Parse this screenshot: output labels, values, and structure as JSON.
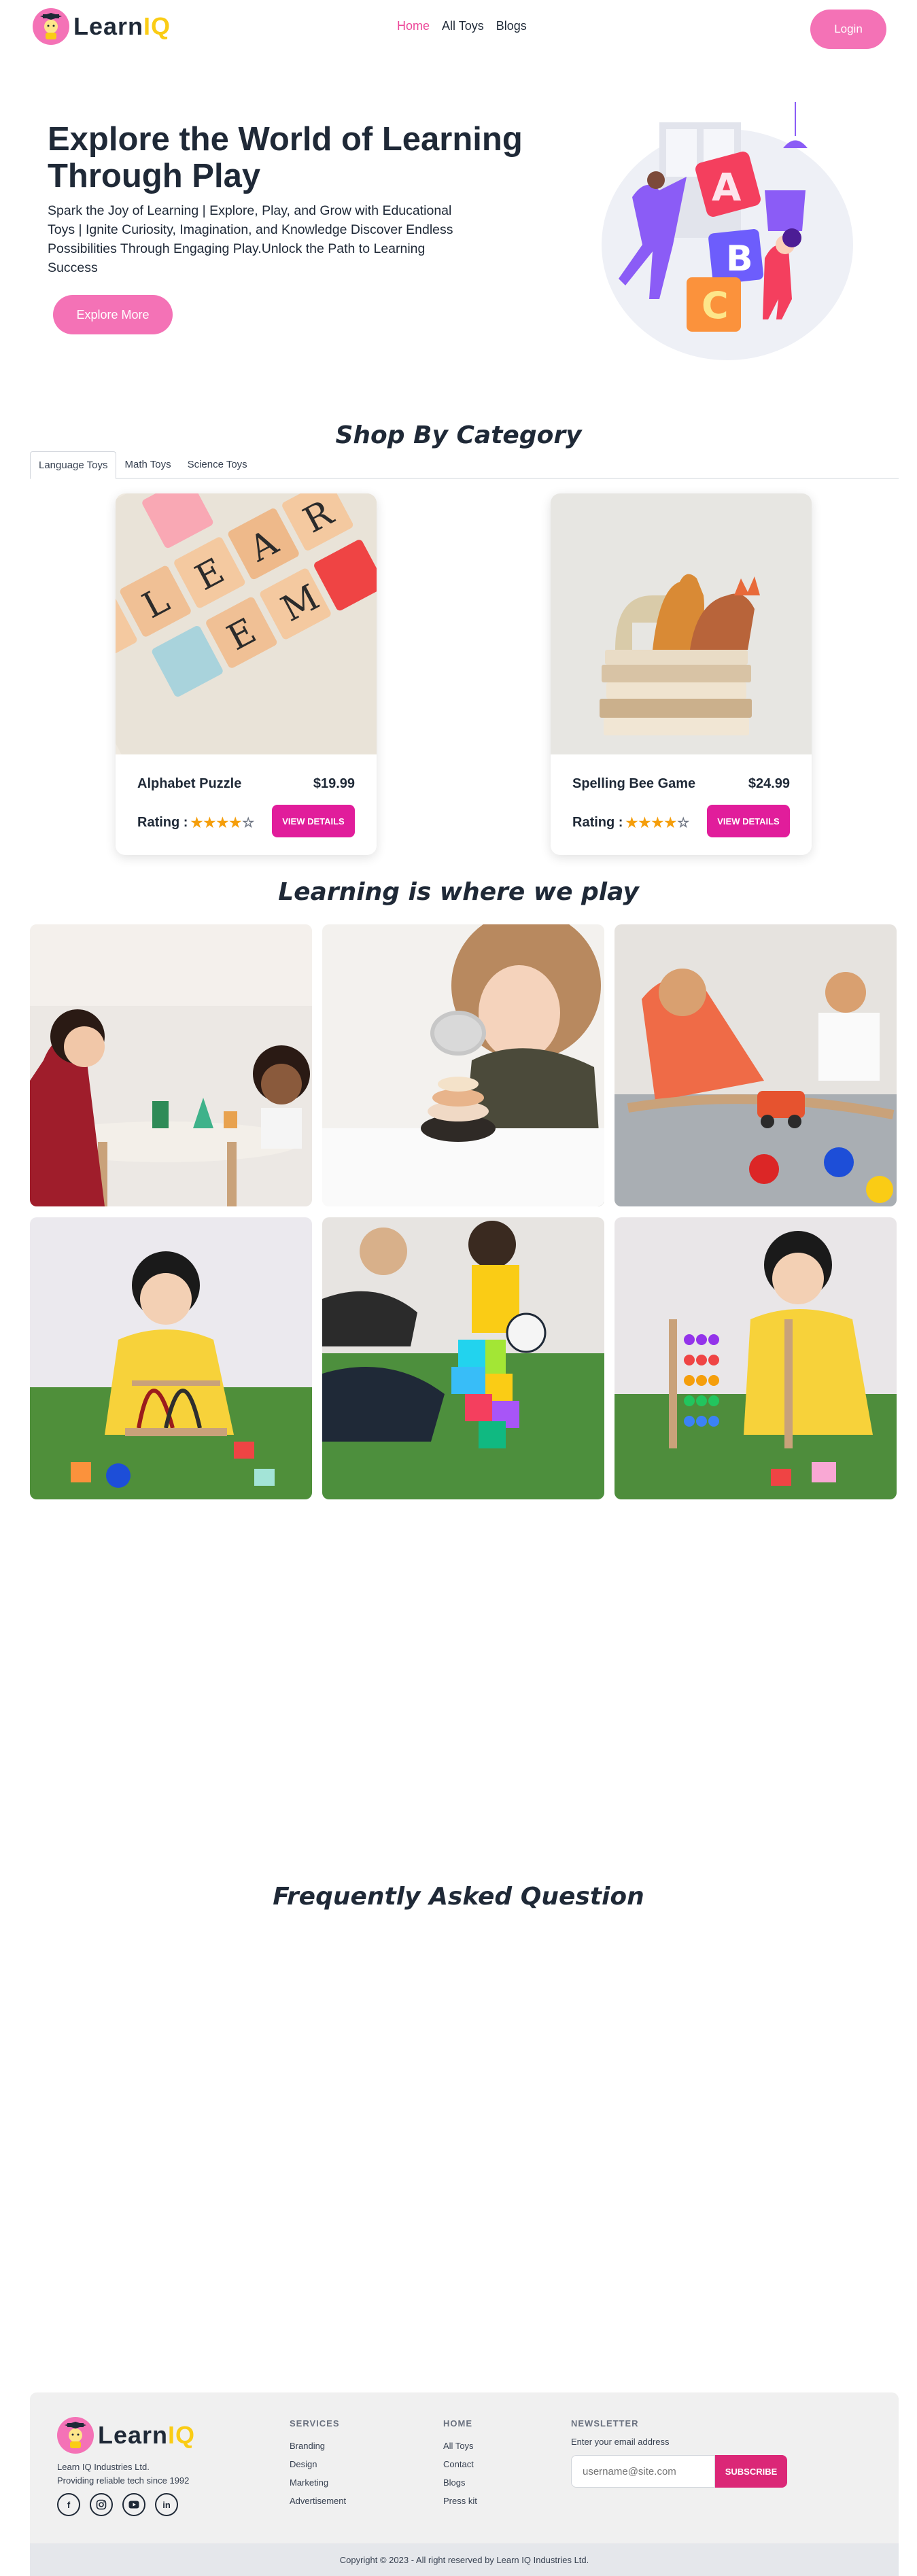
{
  "brand": {
    "part1": "Learn",
    "part2": "IQ"
  },
  "nav": {
    "links": [
      {
        "label": "Home",
        "active": true
      },
      {
        "label": "All Toys",
        "active": false
      },
      {
        "label": "Blogs",
        "active": false
      }
    ],
    "login_label": "Login"
  },
  "hero": {
    "title": "Explore the World of Learning Through Play",
    "description": "Spark the Joy of Learning | Explore, Play, and Grow with Educational Toys | Ignite Curiosity, Imagination, and Knowledge Discover Endless Possibilities Through Engaging Play.Unlock the Path to Learning Success",
    "button_label": "Explore More"
  },
  "category": {
    "title": "Shop By Category",
    "tabs": [
      "Language Toys",
      "Math Toys",
      "Science Toys"
    ],
    "active_tab": 0,
    "products": [
      {
        "name": "Alphabet Puzzle",
        "price": "$19.99",
        "rating_label": "Rating :",
        "rating": 4.5,
        "button_label": "VIEW DETAILS"
      },
      {
        "name": "Spelling Bee Game",
        "price": "$24.99",
        "rating_label": "Rating :",
        "rating": 4.5,
        "button_label": "VIEW DETAILS"
      }
    ]
  },
  "gallery": {
    "title": "Learning is where we play",
    "images": [
      "girls-wooden-toys",
      "child-stacking-rings",
      "boy-toy-train",
      "girl-bead-maze",
      "kids-building-blocks",
      "girl-abacus"
    ]
  },
  "faq": {
    "title": "Frequently Asked Question"
  },
  "footer": {
    "brand": {
      "part1": "Learn",
      "part2": "IQ"
    },
    "company": "Learn IQ Industries Ltd.",
    "tagline": "Providing reliable tech since 1992",
    "socials": [
      "f",
      "ig",
      "yt",
      "in"
    ],
    "columns": [
      {
        "title": "SERVICES",
        "links": [
          "Branding",
          "Design",
          "Marketing",
          "Advertisement"
        ]
      },
      {
        "title": "HOME",
        "links": [
          "All Toys",
          "Contact",
          "Blogs",
          "Press kit"
        ]
      }
    ],
    "newsletter": {
      "title": "NEWSLETTER",
      "label": "Enter your email address",
      "placeholder": "username@site.com",
      "button_label": "SUBSCRIBE"
    },
    "copyright": "Copyright © 2023 - All right reserved by Learn IQ Industries Ltd."
  },
  "colors": {
    "accent": "#f472b6",
    "button": "#e11d9b",
    "brand_yellow": "#facc15"
  }
}
